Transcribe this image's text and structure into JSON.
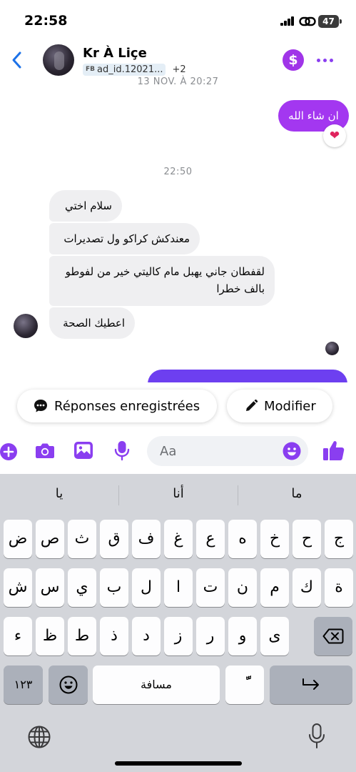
{
  "status_bar": {
    "time": "22:58",
    "battery": "47"
  },
  "header": {
    "contact_name": "Kr À Liçe",
    "fb_prefix": "FB",
    "ad_id": "ad_id.12021...",
    "extra_count": "+2",
    "dollar_symbol": "$"
  },
  "conversation": {
    "top_date": "13 NOV. À 20:27",
    "outgoing": [
      {
        "text": "ان شاء الله",
        "reaction": "❤"
      }
    ],
    "time_divider": "22:50",
    "incoming": [
      {
        "text": "سلام اختي"
      },
      {
        "text": "معندكش كراكو ول تصديرات"
      },
      {
        "text": "لقفطان جاني يهبل مام كاليتي خير من لفوطو بالف خطرا"
      },
      {
        "text": "اعطيك الصحة"
      }
    ]
  },
  "quick_replies": {
    "saved_label": "Réponses enregistrées",
    "edit_label": "Modifier"
  },
  "composer": {
    "placeholder": "Aa"
  },
  "keyboard": {
    "suggestions": [
      "يا",
      "أنا",
      "ما"
    ],
    "row1": [
      "ض",
      "ص",
      "ث",
      "ق",
      "ف",
      "غ",
      "ع",
      "ه",
      "خ",
      "ح",
      "ج"
    ],
    "row2": [
      "ش",
      "س",
      "ي",
      "ب",
      "ل",
      "ا",
      "ت",
      "ن",
      "م",
      "ك",
      "ة"
    ],
    "row3": [
      "ء",
      "ظ",
      "ط",
      "ذ",
      "د",
      "ز",
      "ر",
      "و",
      "ى"
    ],
    "numbers_key": "١٢٣",
    "space_label": "مسافة",
    "diacritic_key": "ًّ"
  }
}
